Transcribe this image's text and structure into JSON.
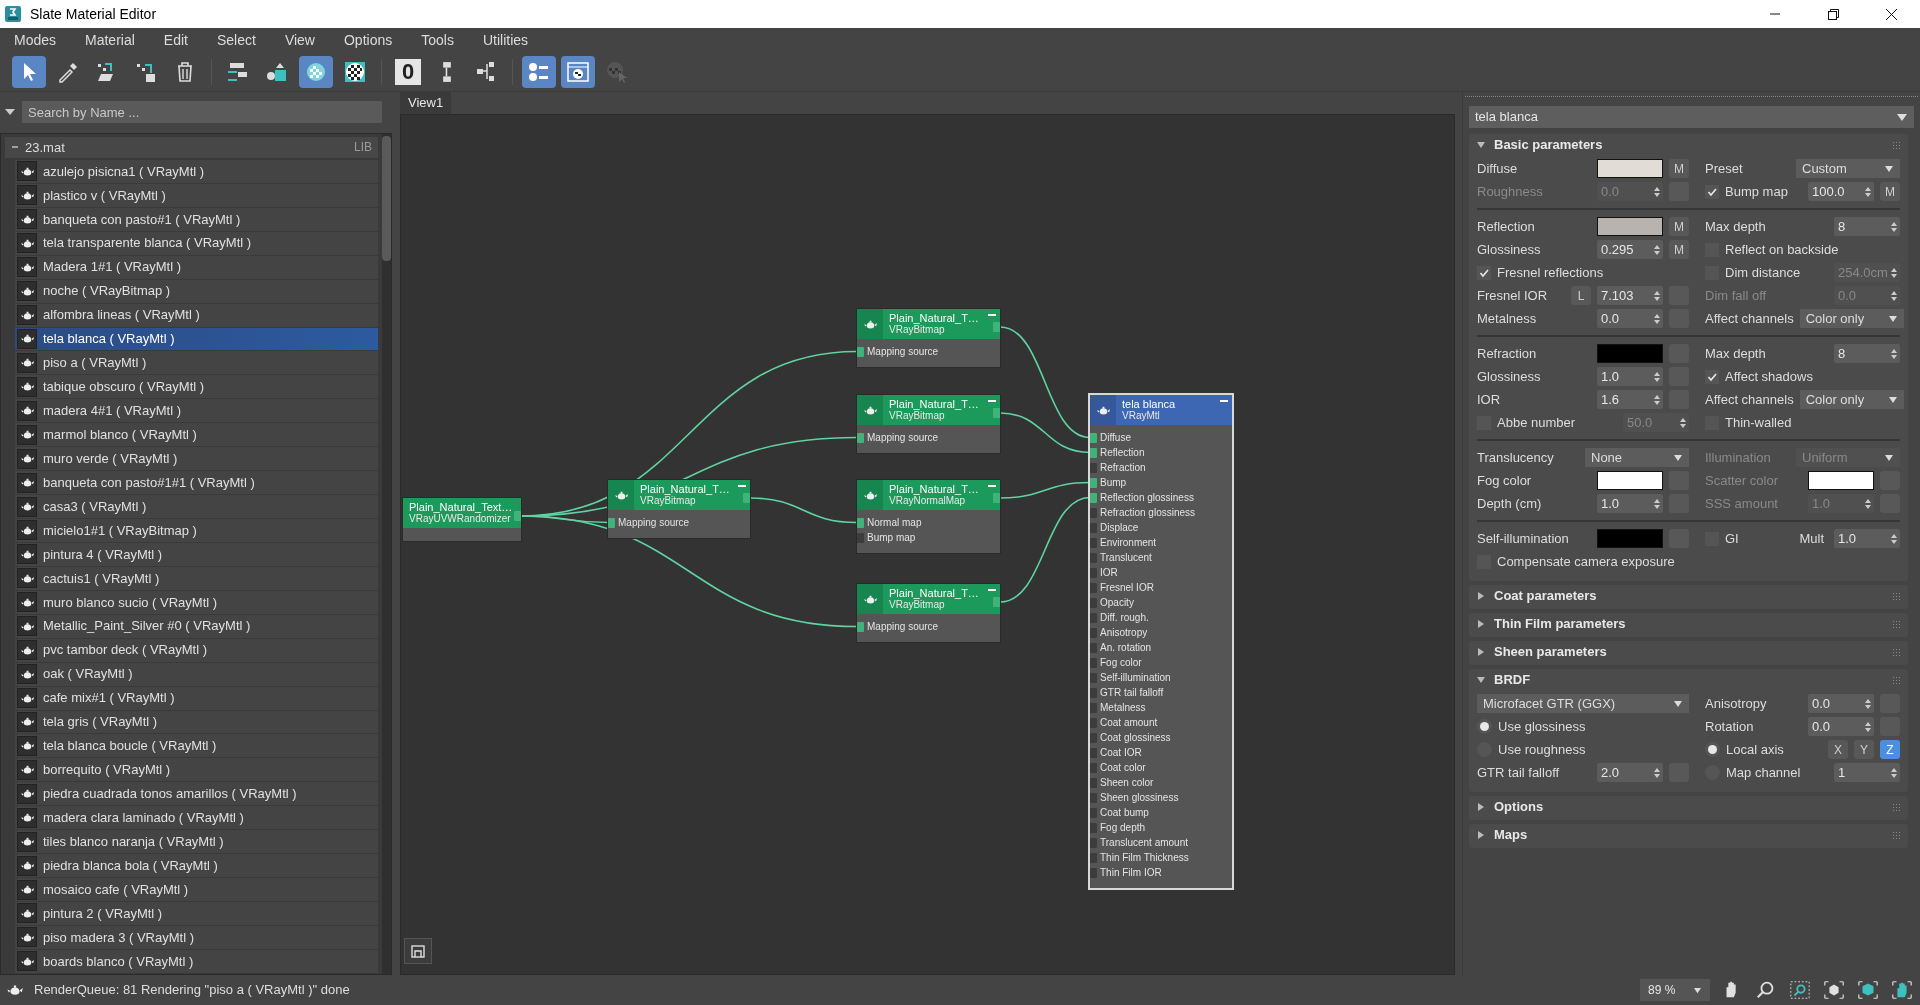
{
  "window": {
    "title": "Slate Material Editor"
  },
  "menu": [
    "Modes",
    "Material",
    "Edit",
    "Select",
    "View",
    "Options",
    "Tools",
    "Utilities"
  ],
  "toolbar": [
    {
      "kind": "select",
      "selected": true
    },
    {
      "kind": "eyedropper",
      "selected": false
    },
    {
      "kind": "put-to-library",
      "selected": false
    },
    {
      "kind": "assign",
      "selected": false
    },
    {
      "kind": "delete",
      "selected": false
    },
    {
      "kind": "move-children",
      "selected": false
    },
    {
      "kind": "hide-unused",
      "selected": false
    },
    {
      "kind": "background",
      "selected": true
    },
    {
      "kind": "checker",
      "selected": false
    },
    {
      "kind": "text",
      "text": "0",
      "selected": false
    },
    {
      "kind": "layout",
      "selected": false
    },
    {
      "kind": "layout-children",
      "selected": false
    },
    {
      "kind": "params",
      "selected": true
    },
    {
      "kind": "show-map",
      "selected": true
    },
    {
      "kind": "pick",
      "selected": false
    }
  ],
  "search": {
    "placeholder": "Search by Name ..."
  },
  "library": {
    "name": "23.mat",
    "tag": "LIB",
    "expanded": true,
    "items": [
      {
        "name": "azulejo pisicna1 ( VRayMtl )",
        "selected": false
      },
      {
        "name": "plastico v ( VRayMtl )",
        "selected": false
      },
      {
        "name": "banqueta con pasto#1 ( VRayMtl )",
        "selected": false
      },
      {
        "name": "tela transparente blanca ( VRayMtl )",
        "selected": false
      },
      {
        "name": "Madera 1#1 ( VRayMtl )",
        "selected": false
      },
      {
        "name": "noche ( VRayBitmap )",
        "selected": false
      },
      {
        "name": "alfombra lineas ( VRayMtl )",
        "selected": false
      },
      {
        "name": "tela blanca ( VRayMtl )",
        "selected": true
      },
      {
        "name": "piso a ( VRayMtl )",
        "selected": false
      },
      {
        "name": "tabique obscuro ( VRayMtl )",
        "selected": false
      },
      {
        "name": "madera 4#1 ( VRayMtl )",
        "selected": false
      },
      {
        "name": "marmol blanco ( VRayMtl )",
        "selected": false
      },
      {
        "name": "muro verde ( VRayMtl )",
        "selected": false
      },
      {
        "name": "banqueta con pasto#1#1 ( VRayMtl )",
        "selected": false
      },
      {
        "name": "casa3 ( VRayMtl )",
        "selected": false
      },
      {
        "name": "micielo1#1 ( VRayBitmap )",
        "selected": false
      },
      {
        "name": "pintura 4 ( VRayMtl )",
        "selected": false
      },
      {
        "name": "cactuis1 ( VRayMtl )",
        "selected": false
      },
      {
        "name": "muro blanco sucio ( VRayMtl )",
        "selected": false
      },
      {
        "name": "Metallic_Paint_Silver #0 ( VRayMtl )",
        "selected": false
      },
      {
        "name": "pvc tambor deck ( VRayMtl )",
        "selected": false
      },
      {
        "name": "oak ( VRayMtl )",
        "selected": false
      },
      {
        "name": "cafe mix#1 ( VRayMtl )",
        "selected": false
      },
      {
        "name": "tela gris ( VRayMtl )",
        "selected": false
      },
      {
        "name": "tela blanca boucle ( VRayMtl )",
        "selected": false
      },
      {
        "name": "borrequito ( VRayMtl )",
        "selected": false
      },
      {
        "name": "piedra cuadrada tonos amarillos ( VRayMtl )",
        "selected": false
      },
      {
        "name": "madera clara laminado ( VRayMtl )",
        "selected": false
      },
      {
        "name": "tiles blanco naranja ( VRayMtl )",
        "selected": false
      },
      {
        "name": "piedra blanca bola ( VRayMtl )",
        "selected": false
      },
      {
        "name": "mosaico cafe ( VRayMtl )",
        "selected": false
      },
      {
        "name": "pintura 2 ( VRayMtl )",
        "selected": false
      },
      {
        "name": "piso madera 3 ( VRayMtl )",
        "selected": false
      },
      {
        "name": "boards blanco ( VRayMtl )",
        "selected": false
      }
    ]
  },
  "view_tabs": [
    {
      "label": "View1",
      "selected": true
    }
  ],
  "nodes": [
    {
      "title": "Plain_Natural_Text…",
      "type": "VRayUVWRandomizer",
      "kind": "map",
      "selected": false
    },
    {
      "title": "Plain_Natural_T…",
      "type": "VRayBitmap",
      "kind": "map",
      "selected": false,
      "inputs": [
        {
          "label": "Mapping source",
          "connected": true
        }
      ]
    },
    {
      "title": "Plain_Natural_T…",
      "type": "VRayBitmap",
      "kind": "map",
      "selected": false,
      "inputs": [
        {
          "label": "Mapping source",
          "connected": true
        }
      ]
    },
    {
      "title": "Plain_Natural_T…",
      "type": "VRayBitmap",
      "kind": "map",
      "selected": false,
      "inputs": [
        {
          "label": "Mapping source",
          "connected": true
        }
      ]
    },
    {
      "title": "Plain_Natural_T…",
      "type": "VRayNormalMap",
      "kind": "map",
      "selected": false,
      "inputs": [
        {
          "label": "Normal map",
          "connected": true
        },
        {
          "label": "Bump map",
          "connected": false
        }
      ]
    },
    {
      "title": "Plain_Natural_T…",
      "type": "VRayBitmap",
      "kind": "map",
      "selected": false,
      "inputs": [
        {
          "label": "Mapping source",
          "connected": true
        }
      ]
    },
    {
      "title": "tela blanca",
      "type": "VRayMtl",
      "kind": "material",
      "selected": true,
      "inputs": [
        {
          "label": "Diffuse",
          "connected": true
        },
        {
          "label": "Reflection",
          "connected": true
        },
        {
          "label": "Refraction",
          "connected": false
        },
        {
          "label": "Bump",
          "connected": true
        },
        {
          "label": "Reflection glossiness",
          "connected": true
        },
        {
          "label": "Refraction glossiness",
          "connected": false
        },
        {
          "label": "Displace",
          "connected": false
        },
        {
          "label": "Environment",
          "connected": false
        },
        {
          "label": "Translucent",
          "connected": false
        },
        {
          "label": "IOR",
          "connected": false
        },
        {
          "label": "Fresnel IOR",
          "connected": false
        },
        {
          "label": "Opacity",
          "connected": false
        },
        {
          "label": "Diff. rough.",
          "connected": false
        },
        {
          "label": "Anisotropy",
          "connected": false
        },
        {
          "label": "An. rotation",
          "connected": false
        },
        {
          "label": "Fog color",
          "connected": false
        },
        {
          "label": "Self-illumination",
          "connected": false
        },
        {
          "label": "GTR tail falloff",
          "connected": false
        },
        {
          "label": "Metalness",
          "connected": false
        },
        {
          "label": "Coat amount",
          "connected": false
        },
        {
          "label": "Coat glossiness",
          "connected": false
        },
        {
          "label": "Coat IOR",
          "connected": false
        },
        {
          "label": "Coat color",
          "connected": false
        },
        {
          "label": "Sheen color",
          "connected": false
        },
        {
          "label": "Sheen glossiness",
          "connected": false
        },
        {
          "label": "Coat bump",
          "connected": false
        },
        {
          "label": "Fog depth",
          "connected": false
        },
        {
          "label": "Translucent amount",
          "connected": false
        },
        {
          "label": "Thin Film Thickness",
          "connected": false
        },
        {
          "label": "Thin Film IOR",
          "connected": false
        }
      ]
    }
  ],
  "material_selector": {
    "value": "tela blanca"
  },
  "rollouts": [
    {
      "title": "Basic parameters",
      "expanded": true,
      "groups": [
        {
          "rows": [
            {
              "left": [
                {
                  "kind": "label",
                  "text": "Diffuse",
                  "disabled": false
                },
                {
                  "kind": "swatch",
                  "color": "#e2dcd6"
                },
                {
                  "kind": "map",
                  "text": "M"
                }
              ],
              "right": [
                {
                  "kind": "label",
                  "text": "Preset",
                  "disabled": false
                },
                {
                  "kind": "dropdown",
                  "value": "Custom",
                  "disabled": false
                }
              ]
            },
            {
              "left": [
                {
                  "kind": "label",
                  "text": "Roughness",
                  "disabled": true
                },
                {
                  "kind": "spinner",
                  "value": "0.0",
                  "disabled": true
                },
                {
                  "kind": "map"
                }
              ],
              "right": [
                {
                  "kind": "check",
                  "text": "Bump map",
                  "checked": true
                },
                {
                  "kind": "spinner",
                  "value": "100.0",
                  "disabled": false
                },
                {
                  "kind": "map",
                  "text": "M"
                }
              ]
            }
          ]
        },
        {
          "rows": [
            {
              "left": [
                {
                  "kind": "label",
                  "text": "Reflection",
                  "disabled": false
                },
                {
                  "kind": "swatch",
                  "color": "#b9b3b0"
                },
                {
                  "kind": "map",
                  "text": "M"
                }
              ],
              "right": [
                {
                  "kind": "label",
                  "text": "Max depth",
                  "disabled": false
                },
                {
                  "kind": "spinner",
                  "value": "8",
                  "disabled": false
                }
              ]
            },
            {
              "left": [
                {
                  "kind": "label",
                  "text": "Glossiness",
                  "disabled": false
                },
                {
                  "kind": "spinner",
                  "value": "0.295",
                  "disabled": false
                },
                {
                  "kind": "map",
                  "text": "M"
                }
              ],
              "right": [
                {
                  "kind": "check",
                  "text": "Reflect on backside",
                  "checked": false
                }
              ]
            },
            {
              "left": [
                {
                  "kind": "check",
                  "text": "Fresnel reflections",
                  "checked": true
                }
              ],
              "right": [
                {
                  "kind": "check",
                  "text": "Dim distance",
                  "checked": false
                },
                {
                  "kind": "spinner",
                  "value": "254.0cm",
                  "disabled": true
                }
              ]
            },
            {
              "left": [
                {
                  "kind": "label",
                  "text": "Fresnel IOR",
                  "disabled": false
                },
                {
                  "kind": "lock",
                  "text": "L"
                },
                {
                  "kind": "spinner",
                  "value": "7.103",
                  "disabled": false
                },
                {
                  "kind": "map"
                }
              ],
              "right": [
                {
                  "kind": "label",
                  "text": "Dim fall off",
                  "disabled": true
                },
                {
                  "kind": "spinner",
                  "value": "0.0",
                  "disabled": true
                }
              ]
            },
            {
              "left": [
                {
                  "kind": "label",
                  "text": "Metalness",
                  "disabled": false
                },
                {
                  "kind": "spinner",
                  "value": "0.0",
                  "disabled": false
                },
                {
                  "kind": "map"
                }
              ],
              "right": [
                {
                  "kind": "label",
                  "text": "Affect channels",
                  "disabled": false
                },
                {
                  "kind": "dropdown",
                  "value": "Color only",
                  "disabled": false
                }
              ]
            }
          ]
        },
        {
          "rows": [
            {
              "left": [
                {
                  "kind": "label",
                  "text": "Refraction",
                  "disabled": false
                },
                {
                  "kind": "swatch",
                  "color": "#000000"
                },
                {
                  "kind": "map"
                }
              ],
              "right": [
                {
                  "kind": "label",
                  "text": "Max depth",
                  "disabled": false
                },
                {
                  "kind": "spinner",
                  "value": "8",
                  "disabled": false
                }
              ]
            },
            {
              "left": [
                {
                  "kind": "label",
                  "text": "Glossiness",
                  "disabled": false
                },
                {
                  "kind": "spinner",
                  "value": "1.0",
                  "disabled": false
                },
                {
                  "kind": "map"
                }
              ],
              "right": [
                {
                  "kind": "check",
                  "text": "Affect shadows",
                  "checked": true
                }
              ]
            },
            {
              "left": [
                {
                  "kind": "label",
                  "text": "IOR",
                  "disabled": false
                },
                {
                  "kind": "spinner",
                  "value": "1.6",
                  "disabled": false
                },
                {
                  "kind": "map"
                }
              ],
              "right": [
                {
                  "kind": "label",
                  "text": "Affect channels",
                  "disabled": false
                },
                {
                  "kind": "dropdown",
                  "value": "Color only",
                  "disabled": false
                }
              ]
            },
            {
              "left": [
                {
                  "kind": "check",
                  "text": "Abbe number",
                  "checked": false
                },
                {
                  "kind": "spinner",
                  "value": "50.0",
                  "disabled": true
                }
              ],
              "right": [
                {
                  "kind": "check",
                  "text": "Thin-walled",
                  "checked": false
                }
              ]
            }
          ]
        },
        {
          "rows": [
            {
              "left": [
                {
                  "kind": "label",
                  "text": "Translucency",
                  "disabled": false
                },
                {
                  "kind": "dropdown",
                  "value": "None",
                  "disabled": false
                }
              ],
              "right": [
                {
                  "kind": "label",
                  "text": "Illumination",
                  "disabled": true
                },
                {
                  "kind": "dropdown",
                  "value": "Uniform",
                  "disabled": true
                }
              ]
            },
            {
              "left": [
                {
                  "kind": "label",
                  "text": "Fog color",
                  "disabled": false
                },
                {
                  "kind": "swatch",
                  "color": "#ffffff"
                },
                {
                  "kind": "map"
                }
              ],
              "right": [
                {
                  "kind": "label",
                  "text": "Scatter color",
                  "disabled": true
                },
                {
                  "kind": "swatch",
                  "color": "#ffffff"
                },
                {
                  "kind": "map"
                }
              ]
            },
            {
              "left": [
                {
                  "kind": "label",
                  "text": "Depth (cm)",
                  "disabled": false
                },
                {
                  "kind": "spinner",
                  "value": "1.0",
                  "disabled": false
                },
                {
                  "kind": "map"
                }
              ],
              "right": [
                {
                  "kind": "label",
                  "text": "SSS amount",
                  "disabled": true
                },
                {
                  "kind": "spinner",
                  "value": "1.0",
                  "disabled": true
                },
                {
                  "kind": "map"
                }
              ]
            }
          ]
        },
        {
          "rows": [
            {
              "left": [
                {
                  "kind": "label",
                  "text": "Self-illumination",
                  "disabled": false
                },
                {
                  "kind": "swatch",
                  "color": "#000000"
                },
                {
                  "kind": "map"
                }
              ],
              "right": [
                {
                  "kind": "check",
                  "text": "GI",
                  "checked": false
                },
                {
                  "kind": "label",
                  "text": "Mult",
                  "disabled": false
                },
                {
                  "kind": "spinner",
                  "value": "1.0",
                  "disabled": false
                }
              ]
            },
            {
              "left": [
                {
                  "kind": "check",
                  "text": "Compensate camera exposure",
                  "checked": false
                }
              ],
              "right": []
            }
          ]
        }
      ]
    },
    {
      "title": "Coat parameters",
      "expanded": false
    },
    {
      "title": "Thin Film parameters",
      "expanded": false
    },
    {
      "title": "Sheen parameters",
      "expanded": false
    },
    {
      "title": "BRDF",
      "expanded": true,
      "groups": [
        {
          "rows": [
            {
              "left": [
                {
                  "kind": "dropdown",
                  "value": "Microfacet GTR (GGX)",
                  "disabled": false
                }
              ],
              "right": [
                {
                  "kind": "label",
                  "text": "Anisotropy",
                  "disabled": false
                },
                {
                  "kind": "spinner",
                  "value": "0.0",
                  "disabled": false
                },
                {
                  "kind": "map"
                }
              ]
            },
            {
              "left": [
                {
                  "kind": "radio",
                  "text": "Use glossiness",
                  "selected": true
                }
              ],
              "right": [
                {
                  "kind": "label",
                  "text": "Rotation",
                  "disabled": false
                },
                {
                  "kind": "spinner",
                  "value": "0.0",
                  "disabled": false
                },
                {
                  "kind": "map"
                }
              ]
            },
            {
              "left": [
                {
                  "kind": "radio",
                  "text": "Use roughness",
                  "selected": false
                }
              ],
              "right": [
                {
                  "kind": "radio",
                  "text": "Local axis",
                  "selected": true
                },
                {
                  "kind": "toggle",
                  "text": "X",
                  "selected": false
                },
                {
                  "kind": "toggle",
                  "text": "Y",
                  "selected": false
                },
                {
                  "kind": "toggle",
                  "text": "Z",
                  "selected": true
                }
              ]
            },
            {
              "left": [
                {
                  "kind": "label",
                  "text": "GTR tail falloff",
                  "disabled": false
                },
                {
                  "kind": "spinner",
                  "value": "2.0",
                  "disabled": false
                },
                {
                  "kind": "map"
                }
              ],
              "right": [
                {
                  "kind": "radio",
                  "text": "Map channel",
                  "selected": false
                },
                {
                  "kind": "spinner",
                  "value": "1",
                  "disabled": false
                }
              ]
            }
          ]
        }
      ]
    },
    {
      "title": "Options",
      "expanded": false
    },
    {
      "title": "Maps",
      "expanded": false
    }
  ],
  "status_bar": {
    "message": "RenderQueue: 81 Rendering \"piso a ( VRayMtl )\" done",
    "zoom": "89 %"
  }
}
